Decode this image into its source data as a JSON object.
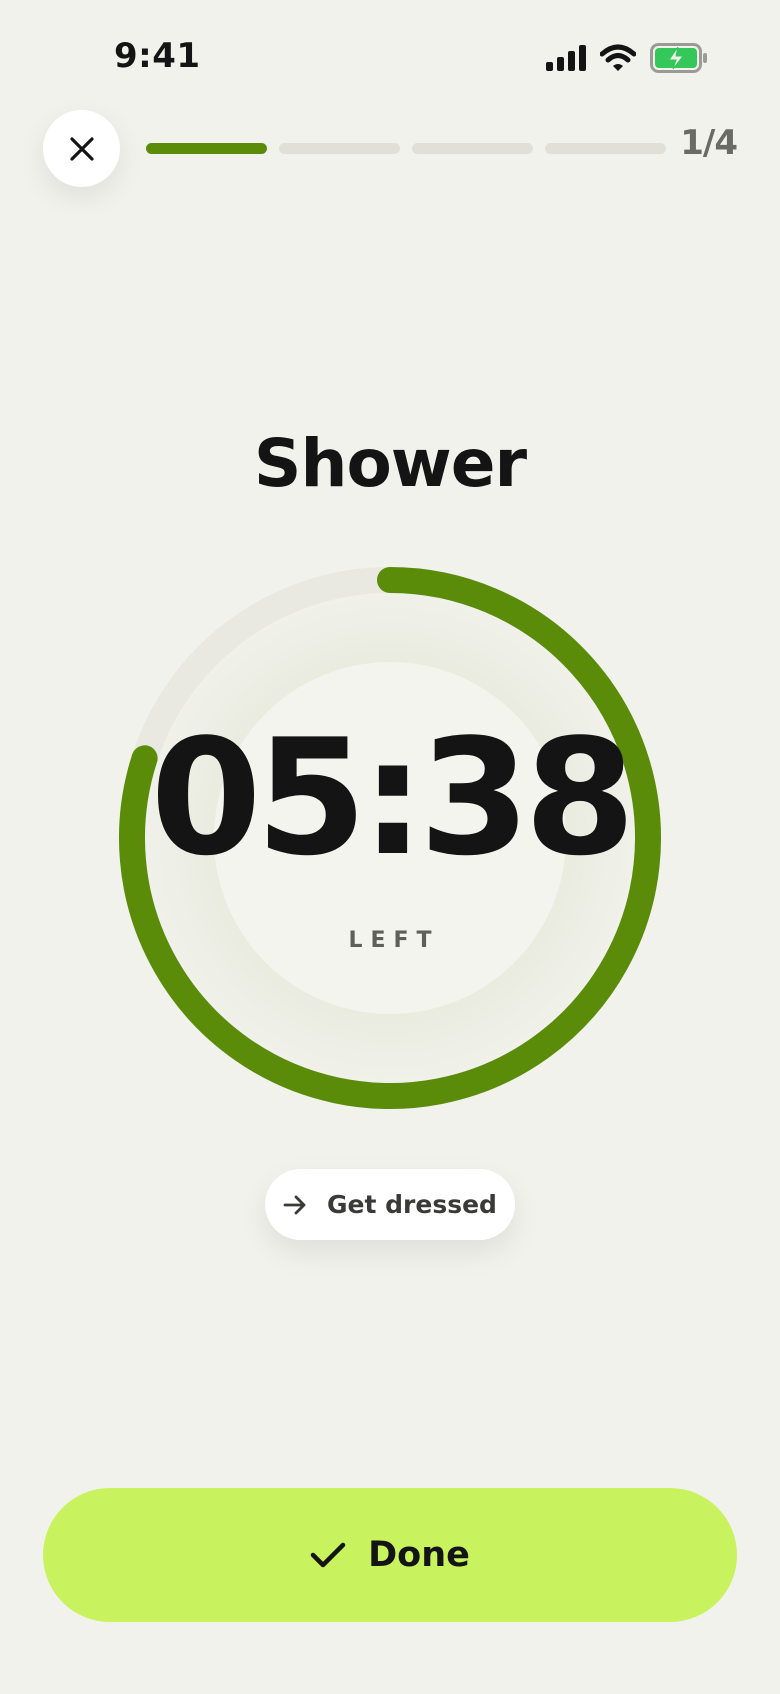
{
  "status_bar": {
    "time": "9:41",
    "icons": [
      "cellular-signal-icon",
      "wifi-icon",
      "battery-charging-icon"
    ],
    "battery_color": "#34c759"
  },
  "header": {
    "close_icon": "close-icon",
    "steps_total": 4,
    "step_current": 1,
    "step_counter": "1/4"
  },
  "task": {
    "title": "Shower",
    "timer_value": "05:38",
    "timer_caption": "LEFT",
    "remaining_fraction": 0.8
  },
  "next_task": {
    "icon": "arrow-right-icon",
    "label": "Get dressed"
  },
  "actions": {
    "done_icon": "checkmark-icon",
    "done_label": "Done"
  },
  "colors": {
    "background": "#f1f2ec",
    "progress_active": "#5a8c0a",
    "progress_inactive": "#e0e0d8",
    "ring_track": "#e9e9e2",
    "primary_button": "#c8f25e",
    "text": "#141414"
  }
}
